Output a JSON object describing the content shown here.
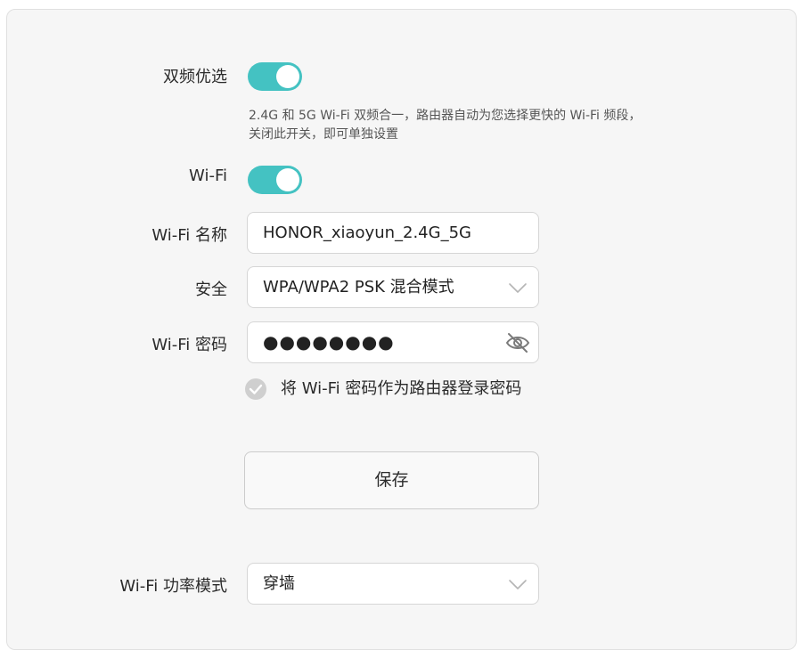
{
  "dual_band": {
    "label": "双频优选",
    "enabled": true,
    "description": "2.4G 和 5G Wi-Fi 双频合一，路由器自动为您选择更快的 Wi-Fi 频段，关闭此开关，即可单独设置"
  },
  "wifi": {
    "label": "Wi-Fi",
    "enabled": true
  },
  "wifi_name": {
    "label": "Wi-Fi 名称",
    "value": "HONOR_xiaoyun_2.4G_5G"
  },
  "security": {
    "label": "安全",
    "value": "WPA/WPA2 PSK 混合模式"
  },
  "wifi_password": {
    "label": "Wi-Fi 密码",
    "masked_value": "●●●●●●●●",
    "visibility_icon": "eye-hidden-icon"
  },
  "use_as_router_password": {
    "label": "将 Wi-Fi 密码作为路由器登录密码",
    "checked": false
  },
  "save": {
    "label": "保存"
  },
  "power_mode": {
    "label": "Wi-Fi 功率模式",
    "value": "穿墙"
  },
  "colors": {
    "accent": "#44c2c2",
    "panel_bg": "#f6f6f6",
    "checkbox_off": "#cfcfcf"
  }
}
